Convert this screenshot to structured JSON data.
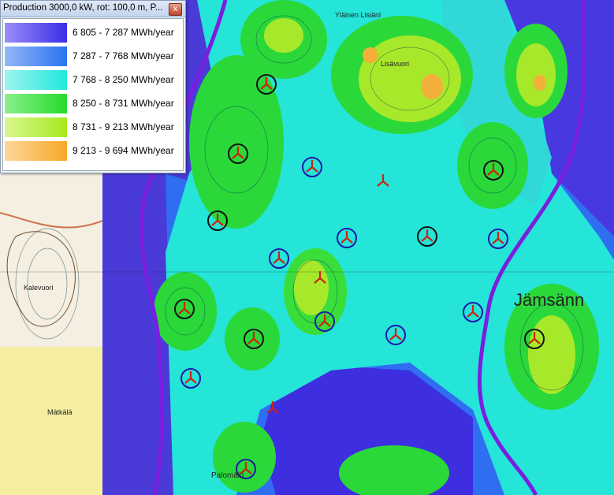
{
  "legend": {
    "title": "Production 3000,0 kW, rot: 100,0 m, P...",
    "close_label": "x",
    "ranges": [
      {
        "label": "6 805 - 7 287 MWh/year",
        "color": "#3a2ee8",
        "light": "#9a8ef8"
      },
      {
        "label": "7 287 - 7 768 MWh/year",
        "color": "#2a72f0",
        "light": "#94b8f8"
      },
      {
        "label": "7 768 - 8 250 MWh/year",
        "color": "#22e8dc",
        "light": "#9af4ee"
      },
      {
        "label": "8 250 - 8 731 MWh/year",
        "color": "#24dc2a",
        "light": "#8cee8e"
      },
      {
        "label": "8 731 - 9 213 MWh/year",
        "color": "#a6ea1e",
        "light": "#d8f690"
      },
      {
        "label": "9 213 - 9 694 MWh/year",
        "color": "#f8a828",
        "light": "#fcd89a"
      }
    ]
  },
  "map_labels": {
    "town": "Jämsänn",
    "lake_hill": "Kalevuori",
    "farm_top": "Yläinen Lisiänl",
    "village": "Lisävuori",
    "bottom_place": "Palomäki",
    "left_place": "Mätkälä"
  },
  "colors": {
    "turbine_marker": "#cc2211",
    "circle_black": "#111111",
    "circle_blue": "#1a1aa8",
    "road": "#7a1ee0"
  }
}
